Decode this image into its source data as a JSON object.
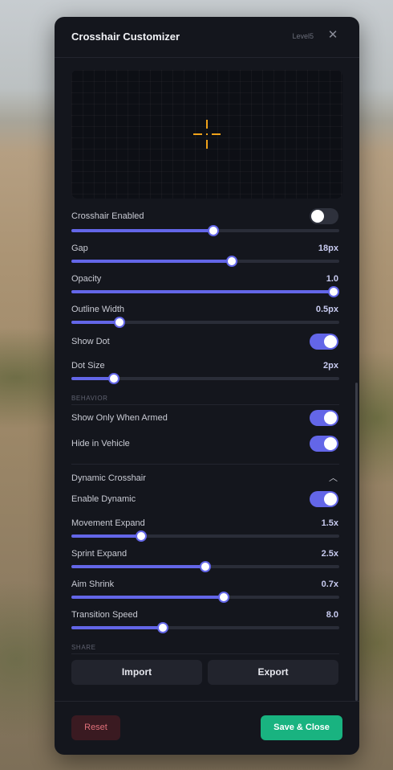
{
  "window": {
    "title": "Crosshair Customizer",
    "level_label": "Level5",
    "close_glyph": "✕"
  },
  "preview": {
    "crosshair_color": "#f0a21a"
  },
  "settings": {
    "crosshair_enabled": {
      "label": "Crosshair Enabled",
      "on": false
    },
    "crosshair_size": {
      "value_fraction": 0.53
    },
    "gap": {
      "label": "Gap",
      "value": "18px",
      "fraction": 0.6
    },
    "opacity": {
      "label": "Opacity",
      "value": "1.0",
      "fraction": 1.0
    },
    "outline_width": {
      "label": "Outline Width",
      "value": "0.5px",
      "fraction": 0.18
    },
    "show_dot": {
      "label": "Show Dot",
      "on": true
    },
    "dot_size": {
      "label": "Dot Size",
      "value": "2px",
      "fraction": 0.16
    }
  },
  "behavior": {
    "heading": "BEHAVIOR",
    "show_only_when_armed": {
      "label": "Show Only When Armed",
      "on": true
    },
    "hide_in_vehicle": {
      "label": "Hide in Vehicle",
      "on": true
    }
  },
  "dynamic": {
    "heading": "Dynamic Crosshair",
    "chevron_glyph": "︿",
    "enable_dynamic": {
      "label": "Enable Dynamic",
      "on": true
    },
    "movement_expand": {
      "label": "Movement Expand",
      "value": "1.5x",
      "fraction": 0.26
    },
    "sprint_expand": {
      "label": "Sprint Expand",
      "value": "2.5x",
      "fraction": 0.5
    },
    "aim_shrink": {
      "label": "Aim Shrink",
      "value": "0.7x",
      "fraction": 0.57
    },
    "transition_speed": {
      "label": "Transition Speed",
      "value": "8.0",
      "fraction": 0.34
    }
  },
  "share": {
    "heading": "SHARE",
    "import_label": "Import",
    "export_label": "Export"
  },
  "footer": {
    "reset_label": "Reset",
    "save_label": "Save & Close"
  },
  "colors": {
    "accent": "#6366e8",
    "save": "#19b380",
    "reset_text": "#e0707a",
    "panel": "#14161d"
  }
}
